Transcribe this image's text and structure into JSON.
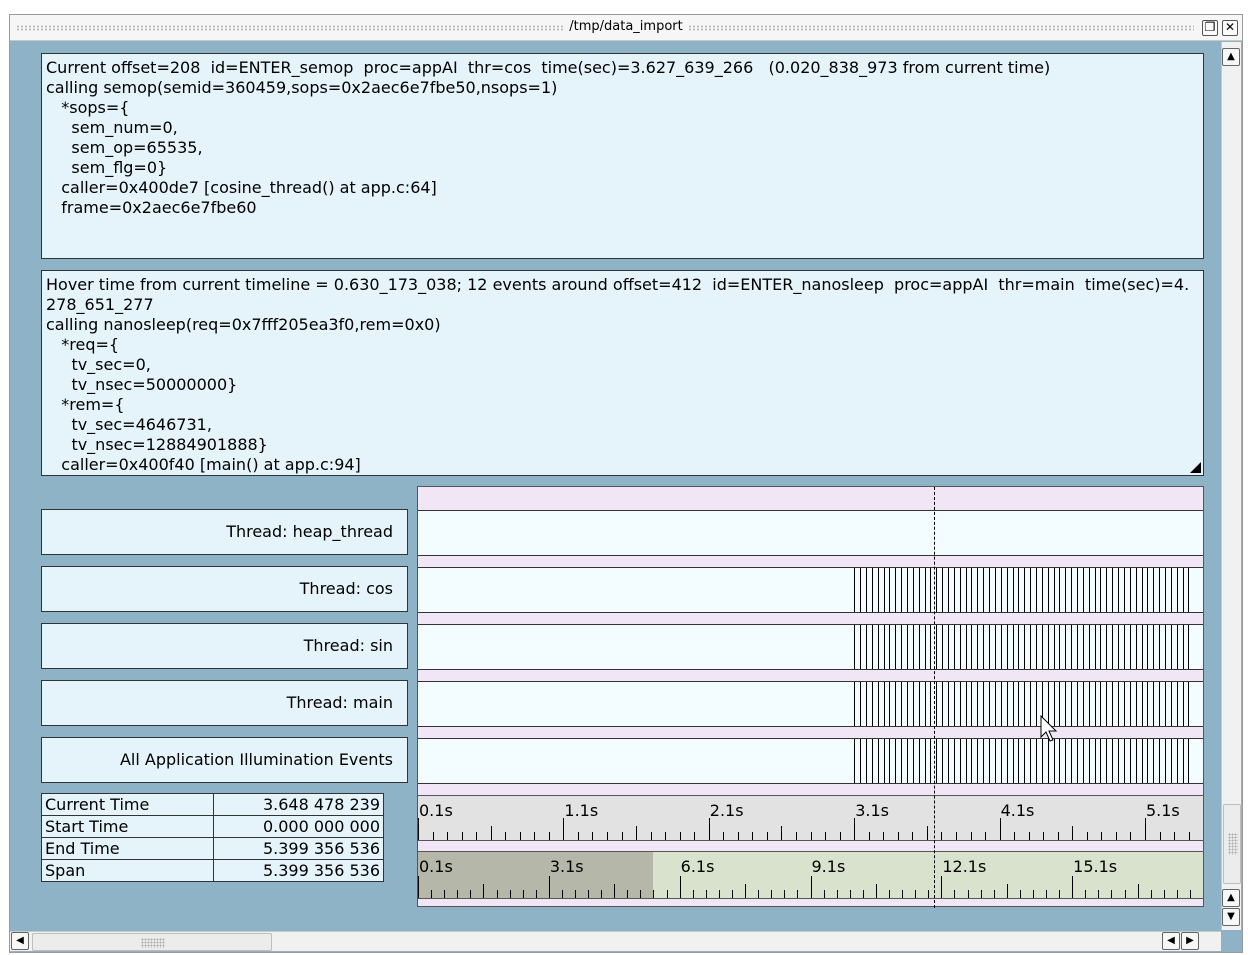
{
  "window": {
    "title": "/tmp/data_import",
    "restore_icon": "restore-icon",
    "close_icon": "close-icon"
  },
  "current_pane": {
    "lines": [
      "Current offset=208  id=ENTER_semop  proc=appAI  thr=cos  time(sec)=3.627_639_266   (0.020_838_973 from current time)",
      "calling semop(semid=360459,sops=0x2aec6e7fbe50,nsops=1)",
      "   *sops={",
      "     sem_num=0,",
      "     sem_op=65535,",
      "     sem_flg=0}",
      "   caller=0x400de7 [cosine_thread() at app.c:64]",
      "   frame=0x2aec6e7fbe60"
    ]
  },
  "hover_pane": {
    "lines": [
      "Hover time from current timeline = 0.630_173_038; 12 events around offset=412  id=ENTER_nanosleep  proc=appAI  thr=main  time(sec)=4.278_651_277",
      "calling nanosleep(req=0x7fff205ea3f0,rem=0x0)",
      "   *req={",
      "     tv_sec=0,",
      "     tv_nsec=50000000}",
      "   *rem={",
      "     tv_sec=4646731,",
      "     tv_nsec=12884901888}",
      "   caller=0x400f40 [main() at app.c:94]"
    ]
  },
  "threads": [
    {
      "label": "Thread: heap_thread",
      "has_events": false
    },
    {
      "label": "Thread: cos",
      "has_events": true
    },
    {
      "label": "Thread: sin",
      "has_events": true
    },
    {
      "label": "Thread: main",
      "has_events": true
    },
    {
      "label": "All Application Illumination Events",
      "has_events": true
    }
  ],
  "event_time_range_sec": [
    3.1,
    5.399
  ],
  "events_per_track": 58,
  "cursor_time_sec": 3.648,
  "axis_top": {
    "range_sec": [
      0.1,
      5.499
    ],
    "labels": [
      "0.1s",
      "1.1s",
      "2.1s",
      "3.1s",
      "4.1s",
      "5.1s"
    ],
    "label_values": [
      0.1,
      1.1,
      2.1,
      3.1,
      4.1,
      5.1
    ]
  },
  "axis_bottom": {
    "range_sec": [
      0.1,
      18.1
    ],
    "labels": [
      "0.1s",
      "3.1s",
      "6.1s",
      "9.1s",
      "12.1s",
      "15.1s"
    ],
    "label_values": [
      0.1,
      3.1,
      6.1,
      9.1,
      12.1,
      15.1
    ],
    "selection_sec": [
      0.1,
      5.499
    ]
  },
  "stats": [
    {
      "label": "Current Time",
      "value": "3.648 478 239"
    },
    {
      "label": "Start Time",
      "value": "0.000 000 000"
    },
    {
      "label": "End Time",
      "value": "5.399 356 536"
    },
    {
      "label": "Span",
      "value": "5.399 356 536"
    }
  ],
  "scrollbars": {
    "up_icon": "arrow-up-icon",
    "down_icon": "arrow-down-icon",
    "left_icon": "arrow-left-icon",
    "right_icon": "arrow-right-icon"
  },
  "colors": {
    "window_bg": "#8fb3c6",
    "pane_bg": "#e5f3fb",
    "track_bg": "#f3fcfe",
    "timeline_bg": "#f1e6f6",
    "axis_top_bg": "#e2e2e2",
    "axis_bottom_bg": "#d8e2cd",
    "axis_selection": "#b5b8a8"
  }
}
